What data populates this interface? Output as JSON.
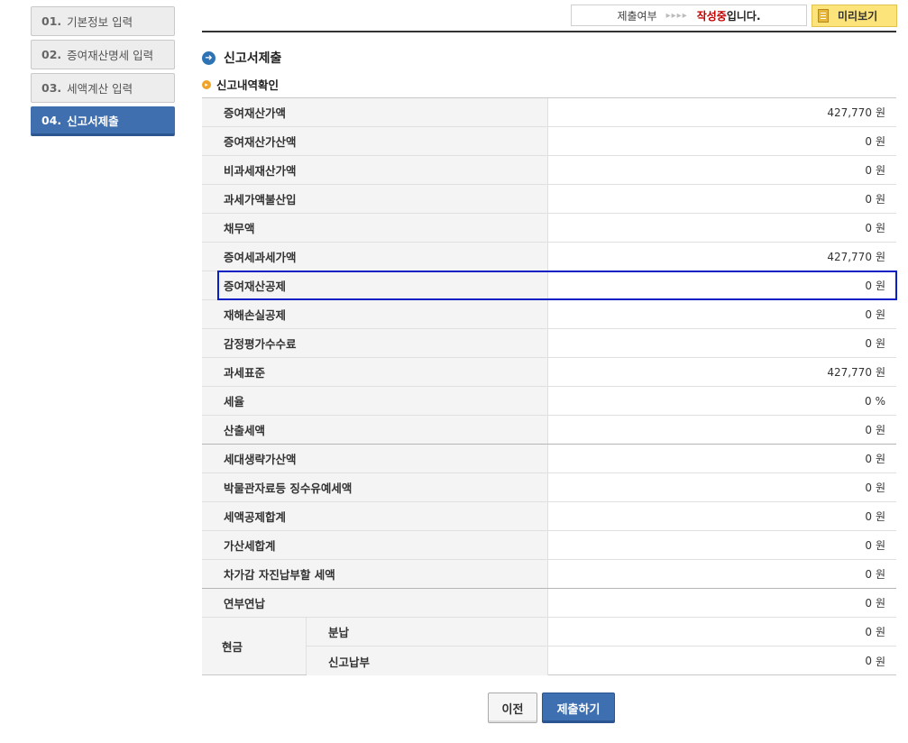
{
  "sidebar": {
    "items": [
      {
        "num": "01.",
        "label": "기본정보 입력",
        "active": false
      },
      {
        "num": "02.",
        "label": "증여재산명세 입력",
        "active": false
      },
      {
        "num": "03.",
        "label": "세액계산 입력",
        "active": false
      },
      {
        "num": "04.",
        "label": "신고서제출",
        "active": true
      }
    ]
  },
  "status": {
    "prefix": "제출여부",
    "arrows": "▸▸▸▸",
    "state": "작성중",
    "suffix": "입니다."
  },
  "preview_label": "미리보기",
  "section_title": "신고서제출",
  "subsection_title": "신고내역확인",
  "rows": [
    {
      "label": "증여재산가액",
      "value": "427,770",
      "unit": "원"
    },
    {
      "label": "증여재산가산액",
      "value": "0",
      "unit": "원"
    },
    {
      "label": "비과세재산가액",
      "value": "0",
      "unit": "원"
    },
    {
      "label": "과세가액불산입",
      "value": "0",
      "unit": "원"
    },
    {
      "label": "채무액",
      "value": "0",
      "unit": "원"
    },
    {
      "label": "증여세과세가액",
      "value": "427,770",
      "unit": "원"
    },
    {
      "label": "증여재산공제",
      "value": "0",
      "unit": "원"
    },
    {
      "label": "재해손실공제",
      "value": "0",
      "unit": "원"
    },
    {
      "label": "감정평가수수료",
      "value": "0",
      "unit": "원"
    },
    {
      "label": "과세표준",
      "value": "427,770",
      "unit": "원"
    },
    {
      "label": "세율",
      "value": "0",
      "unit": "%"
    },
    {
      "label": "산출세액",
      "value": "0",
      "unit": "원"
    },
    {
      "label": "세대생략가산액",
      "value": "0",
      "unit": "원"
    },
    {
      "label": "박물관자료등 징수유예세액",
      "value": "0",
      "unit": "원"
    },
    {
      "label": "세액공제합계",
      "value": "0",
      "unit": "원"
    },
    {
      "label": "가산세합계",
      "value": "0",
      "unit": "원"
    },
    {
      "label": "차가감 자진납부할 세액",
      "value": "0",
      "unit": "원"
    },
    {
      "label": "연부연납",
      "value": "0",
      "unit": "원"
    }
  ],
  "cash": {
    "label": "현금",
    "rows": [
      {
        "label": "분납",
        "value": "0",
        "unit": "원"
      },
      {
        "label": "신고납부",
        "value": "0",
        "unit": "원"
      }
    ]
  },
  "buttons": {
    "prev": "이전",
    "submit": "제출하기"
  }
}
